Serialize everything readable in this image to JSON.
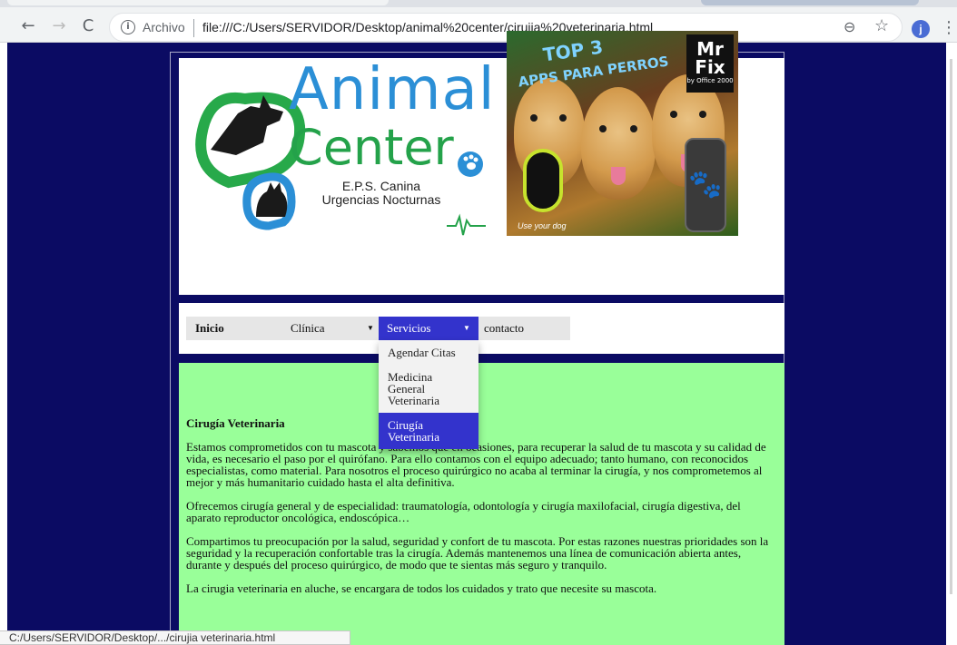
{
  "browser": {
    "back": "←",
    "forward": "→",
    "reload": "C",
    "info_icon": "i",
    "archivo": "Archivo",
    "url": "file:///C:/Users/SERVIDOR/Desktop/animal%20center/cirujia%20veterinaria.html",
    "zoom_icon": "⊖",
    "star_icon": "☆",
    "avatar_letter": "j",
    "menu_icon": "⋮",
    "status_url": "C:/Users/SERVIDOR/Desktop/.../cirujia veterinaria.html"
  },
  "logo": {
    "word1": "Animal",
    "word2": "Center",
    "subtitle1": "E.P.S. Canina",
    "subtitle2": "Urgencias Nocturnas"
  },
  "promo": {
    "top3": "TOP 3",
    "apps": "APPS PARA PERROS",
    "brand": "Mr",
    "brand2": "Fix",
    "brand_sub": "by Office 2000",
    "tag": "Use your dog"
  },
  "nav": {
    "inicio": "Inicio",
    "clinica": "Clínica",
    "servicios": "Servicios",
    "contacto": "contacto",
    "caret": "▼",
    "dropdown": [
      "Agendar Citas",
      "Medicina General Veterinaria",
      "Cirugía Veterinaria"
    ]
  },
  "content": {
    "title": "Cirugía Veterinaria",
    "p1": "Estamos comprometidos con tu mascota y sabemos que en ocasiones, para recuperar la salud de tu mascota y su calidad de vida, es necesario el paso por el quirófano. Para ello contamos con el equipo adecuado; tanto humano, con reconocidos especialistas, como material. Para nosotros el proceso quirúrgico no acaba al terminar la cirugía, y nos comprometemos al mejor y más humanitario cuidado hasta el alta definitiva.",
    "p2": "Ofrecemos cirugía general y de especialidad: traumatología, odontología y cirugía maxilofacial, cirugía digestiva, del aparato reproductor oncológica, endoscópica…",
    "p3": "Compartimos tu preocupación por la salud, seguridad y confort de tu mascota. Por estas razones nuestras prioridades son la seguridad y la recuperación confortable tras la cirugía. Además mantenemos una línea de comunicación abierta antes, durante y después del proceso quirúrgico, de modo que te sientas más seguro y tranquilo.",
    "p4": "La cirugia veterinaria en aluche, se encargara de todos los cuidados y trato que necesite su mascota."
  }
}
